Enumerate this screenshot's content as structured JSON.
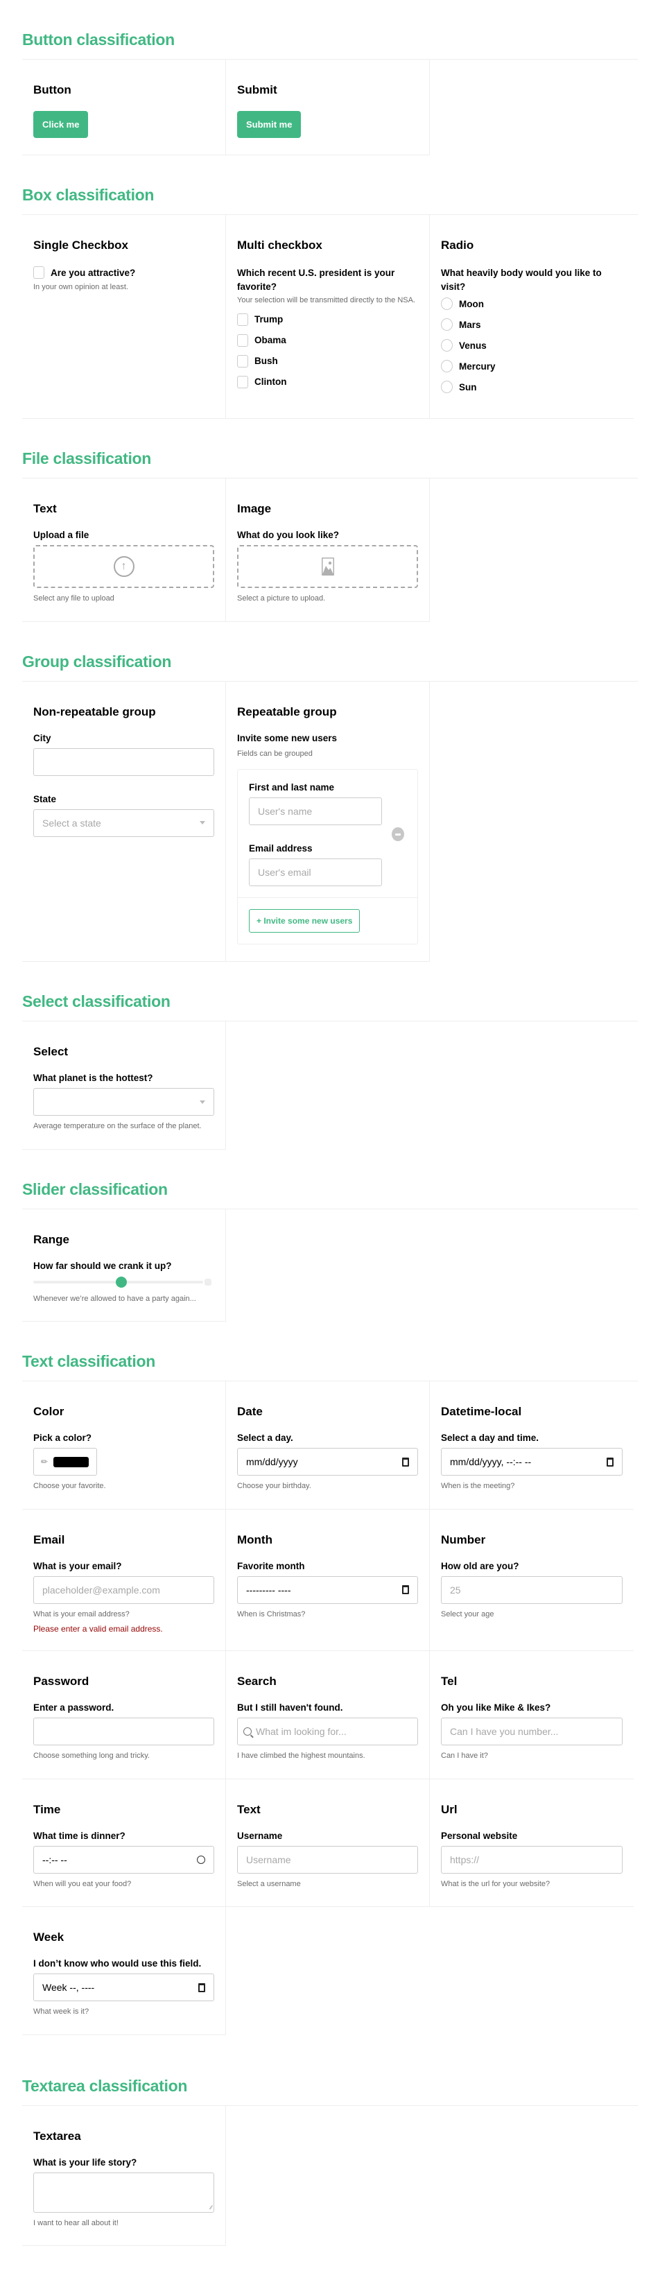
{
  "colors": {
    "accent": "#41b883",
    "error": "#960505",
    "swatch": "#000000"
  },
  "button_section": {
    "title": "Button classification",
    "button": {
      "title": "Button",
      "label": "Click me"
    },
    "submit": {
      "title": "Submit",
      "label": "Submit me"
    }
  },
  "box_section": {
    "title": "Box classification",
    "single": {
      "title": "Single Checkbox",
      "label": "Are you attractive?",
      "help": "In your own opinion at least.",
      "checked": false
    },
    "multi": {
      "title": "Multi checkbox",
      "label": "Which recent U.S. president is your favorite?",
      "help": "Your selection will be transmitted directly to the NSA.",
      "options": [
        "Trump",
        "Obama",
        "Bush",
        "Clinton"
      ]
    },
    "radio": {
      "title": "Radio",
      "label": "What heavily body would you like to visit?",
      "options": [
        "Moon",
        "Mars",
        "Venus",
        "Mercury",
        "Sun"
      ]
    }
  },
  "file_section": {
    "title": "File classification",
    "text": {
      "title": "Text",
      "label": "Upload a file",
      "help": "Select any file to upload",
      "icon": "upload-arrow-icon"
    },
    "image": {
      "title": "Image",
      "label": "What do you look like?",
      "help": "Select a picture to upload.",
      "icon": "image-icon"
    }
  },
  "group_section": {
    "title": "Group classification",
    "nonrepeat": {
      "title": "Non-repeatable group",
      "city_label": "City",
      "city_value": "",
      "state_label": "State",
      "state_placeholder": "Select a state"
    },
    "repeat": {
      "title": "Repeatable group",
      "label": "Invite some new users",
      "help": "Fields can be grouped",
      "name_label": "First and last name",
      "name_placeholder": "User's name",
      "email_label": "Email address",
      "email_placeholder": "User's email",
      "add_label": "+ Invite some new users"
    }
  },
  "select_section": {
    "title": "Select classification",
    "select": {
      "title": "Select",
      "label": "What planet is the hottest?",
      "value": "",
      "help": "Average temperature on the surface of the planet."
    }
  },
  "slider_section": {
    "title": "Slider classification",
    "range": {
      "title": "Range",
      "label": "How far should we crank it up?",
      "value_fraction": 0.52,
      "help": "Whenever we’re allowed to have a party again..."
    }
  },
  "text_section": {
    "title": "Text classification",
    "fields": {
      "color": {
        "title": "Color",
        "label": "Pick a color?",
        "help": "Choose your favorite."
      },
      "date": {
        "title": "Date",
        "label": "Select a day.",
        "value": "mm/dd/yyyy",
        "help": "Choose your birthday."
      },
      "datetime": {
        "title": "Datetime-local",
        "label": "Select a day and time.",
        "value": "mm/dd/yyyy, --:-- --",
        "help": "When is the meeting?"
      },
      "email": {
        "title": "Email",
        "label": "What is your email?",
        "placeholder": "placeholder@example.com",
        "help": "What is your email address?",
        "error": "Please enter a valid email address."
      },
      "month": {
        "title": "Month",
        "label": "Favorite month",
        "value": "--------- ----",
        "help": "When is Christmas?"
      },
      "number": {
        "title": "Number",
        "label": "How old are you?",
        "placeholder": "25",
        "help": "Select your age"
      },
      "password": {
        "title": "Password",
        "label": "Enter a password.",
        "help": "Choose something long and tricky."
      },
      "search": {
        "title": "Search",
        "label": "But I still haven't found.",
        "placeholder": "What im looking for...",
        "help": "I have climbed the highest mountains."
      },
      "tel": {
        "title": "Tel",
        "label": "Oh you like Mike & Ikes?",
        "placeholder": "Can I have you number...",
        "help": "Can I have it?"
      },
      "time": {
        "title": "Time",
        "label": "What time is dinner?",
        "value": "--:-- --",
        "help": "When will you eat your food?"
      },
      "text": {
        "title": "Text",
        "label": "Username",
        "placeholder": "Username",
        "help": "Select a username"
      },
      "url": {
        "title": "Url",
        "label": "Personal website",
        "placeholder": "https://",
        "help": "What is the url for your website?"
      },
      "week": {
        "title": "Week",
        "label": "I don’t know who would use this field.",
        "value": "Week --, ----",
        "help": "What week is it?"
      }
    }
  },
  "textarea_section": {
    "title": "Textarea classification",
    "textarea": {
      "title": "Textarea",
      "label": "What is your life story?",
      "value": "",
      "help": "I want to hear all about it!"
    }
  }
}
